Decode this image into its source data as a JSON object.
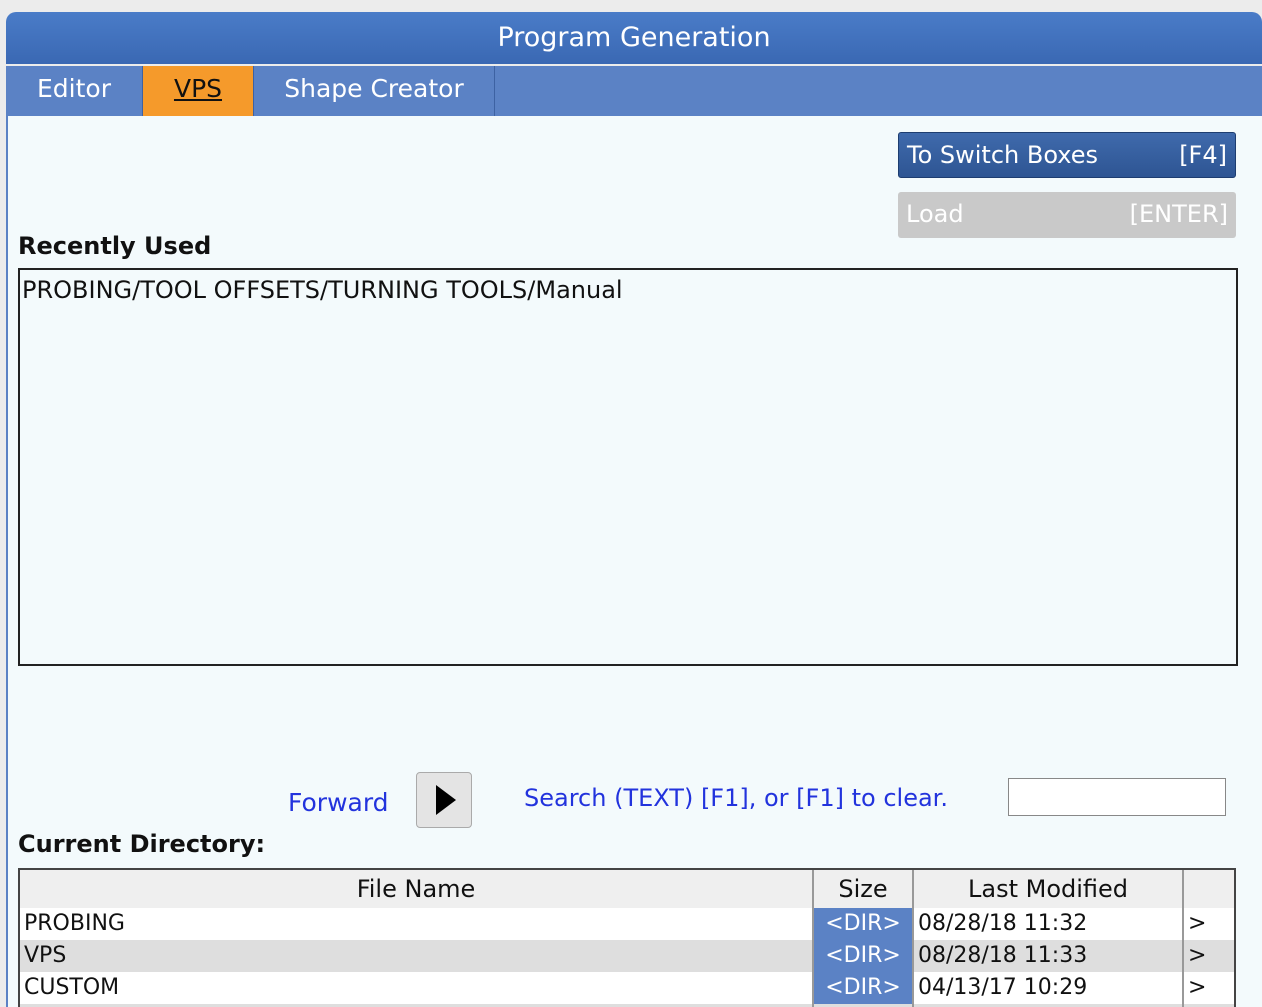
{
  "window": {
    "title": "Program Generation"
  },
  "tabs": [
    {
      "label": "Editor",
      "active": false
    },
    {
      "label": "VPS",
      "active": true
    },
    {
      "label": "Shape Creator",
      "active": false
    }
  ],
  "buttons": {
    "switch_boxes": {
      "label": "To Switch Boxes",
      "key": "[F4]"
    },
    "load": {
      "label": "Load",
      "key": "[ENTER]",
      "enabled": false
    }
  },
  "recently_used": {
    "title": "Recently Used",
    "items": [
      "PROBING/TOOL OFFSETS/TURNING TOOLS/Manual"
    ]
  },
  "navigation": {
    "forward_label": "Forward",
    "search_label": "Search (TEXT) [F1], or [F1] to clear.",
    "search_value": ""
  },
  "current_directory": {
    "title": "Current Directory:",
    "columns": [
      "File Name",
      "Size",
      "Last Modified",
      ""
    ],
    "rows": [
      {
        "name": "PROBING",
        "size": "<DIR>",
        "modified": "08/28/18 11:32",
        "arrow": ">"
      },
      {
        "name": "VPS",
        "size": "<DIR>",
        "modified": "08/28/18 11:33",
        "arrow": ">"
      },
      {
        "name": "CUSTOM",
        "size": "<DIR>",
        "modified": "04/13/17 10:29",
        "arrow": ">"
      }
    ]
  },
  "colors": {
    "title_bar": "#3f6fbd",
    "tab_bar": "#5b82c5",
    "active_tab": "#f59a2b",
    "link_text": "#2233dd",
    "dir_badge": "#5b82c5"
  }
}
